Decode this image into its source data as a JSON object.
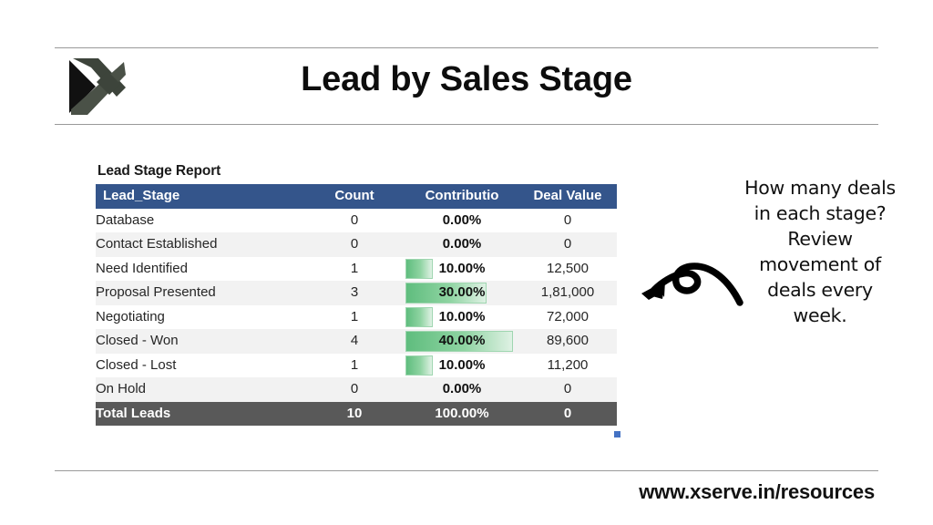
{
  "slide": {
    "title": "Lead by Sales Stage",
    "logo_icon": "xserve-x-logo-icon",
    "footer_url": "www.xserve.in/resources"
  },
  "report": {
    "title": "Lead Stage Report",
    "columns": [
      "Lead_Stage",
      "Count",
      "Contributio",
      "Deal Value"
    ],
    "rows": [
      {
        "stage": "Database",
        "count": "0",
        "contribution": "0.00%",
        "pct": 0,
        "deal_value": "0"
      },
      {
        "stage": "Contact Established",
        "count": "0",
        "contribution": "0.00%",
        "pct": 0,
        "deal_value": "0"
      },
      {
        "stage": "Need Identified",
        "count": "1",
        "contribution": "10.00%",
        "pct": 10,
        "deal_value": "12,500"
      },
      {
        "stage": "Proposal Presented",
        "count": "3",
        "contribution": "30.00%",
        "pct": 30,
        "deal_value": "1,81,000"
      },
      {
        "stage": "Negotiating",
        "count": "1",
        "contribution": "10.00%",
        "pct": 10,
        "deal_value": "72,000"
      },
      {
        "stage": "Closed - Won",
        "count": "4",
        "contribution": "40.00%",
        "pct": 40,
        "deal_value": "89,600"
      },
      {
        "stage": "Closed - Lost",
        "count": "1",
        "contribution": "10.00%",
        "pct": 10,
        "deal_value": "11,200"
      },
      {
        "stage": "On Hold",
        "count": "0",
        "contribution": "0.00%",
        "pct": 0,
        "deal_value": "0"
      }
    ],
    "total": {
      "stage": "Total Leads",
      "count": "10",
      "contribution": "100.00%",
      "deal_value": "0"
    },
    "header_fill": "#34558b",
    "total_fill": "#595959",
    "bar_color": "#5fbd7e"
  },
  "annotation": {
    "arrow_icon": "curly-arrow-left-icon",
    "text": "How many deals in each stage? Review movement of deals every week."
  },
  "chart_data": {
    "type": "table",
    "title": "Lead Stage Report",
    "columns": [
      "Lead_Stage",
      "Count",
      "Contributio",
      "Deal Value"
    ],
    "categories": [
      "Database",
      "Contact Established",
      "Need Identified",
      "Proposal Presented",
      "Negotiating",
      "Closed - Won",
      "Closed - Lost",
      "On Hold"
    ],
    "series": [
      {
        "name": "Count",
        "values": [
          0,
          0,
          1,
          3,
          1,
          4,
          1,
          0
        ]
      },
      {
        "name": "Contribution %",
        "values": [
          0,
          0,
          10,
          30,
          10,
          40,
          10,
          0
        ]
      },
      {
        "name": "Deal Value",
        "values": [
          0,
          0,
          12500,
          181000,
          72000,
          89600,
          11200,
          0
        ]
      }
    ],
    "totals": {
      "Count": 10,
      "Contribution %": 100,
      "Deal Value": 0
    },
    "databar_column": "Contribution %",
    "databar_max": 100,
    "grid": false,
    "legend": "none"
  }
}
